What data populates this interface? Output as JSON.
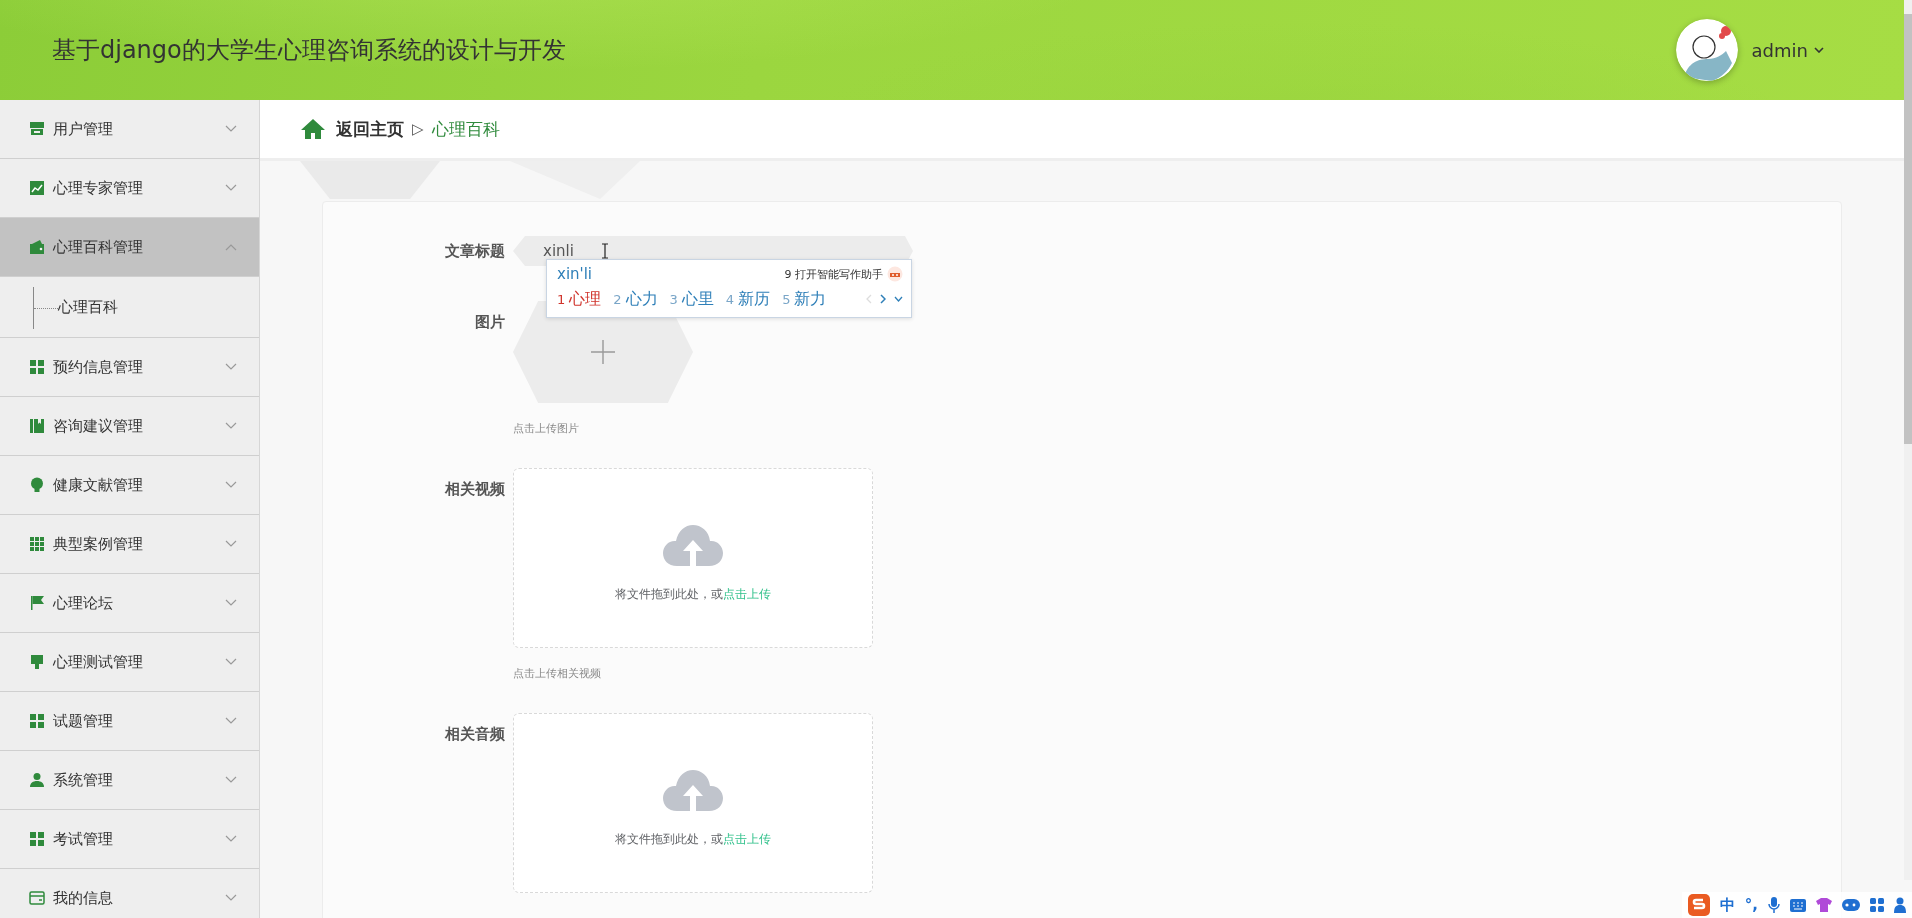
{
  "header": {
    "title": "基于django的大学生心理咨询系统的设计与开发",
    "user": {
      "name": "admin"
    }
  },
  "sidebar": {
    "items": [
      {
        "label": "用户管理",
        "expanded": false,
        "selected": false
      },
      {
        "label": "心理专家管理",
        "expanded": false,
        "selected": false
      },
      {
        "label": "心理百科管理",
        "expanded": true,
        "selected": true,
        "children": [
          {
            "label": "心理百科",
            "selected": false
          }
        ]
      },
      {
        "label": "预约信息管理",
        "expanded": false,
        "selected": false
      },
      {
        "label": "咨询建议管理",
        "expanded": false,
        "selected": false
      },
      {
        "label": "健康文献管理",
        "expanded": false,
        "selected": false
      },
      {
        "label": "典型案例管理",
        "expanded": false,
        "selected": false
      },
      {
        "label": "心理论坛",
        "expanded": false,
        "selected": false
      },
      {
        "label": "心理测试管理",
        "expanded": false,
        "selected": false
      },
      {
        "label": "试题管理",
        "expanded": false,
        "selected": false
      },
      {
        "label": "系统管理",
        "expanded": false,
        "selected": false
      },
      {
        "label": "考试管理",
        "expanded": false,
        "selected": false
      },
      {
        "label": "我的信息",
        "expanded": false,
        "selected": false
      }
    ]
  },
  "breadcrumb": {
    "home": "返回主页",
    "separator": "▷",
    "current": "心理百科"
  },
  "form": {
    "fields": [
      {
        "kind": "text",
        "label": "文章标题",
        "value": "xinli"
      },
      {
        "kind": "image",
        "label": "图片",
        "hint": "点击上传图片"
      },
      {
        "kind": "dropzone",
        "label": "相关视频",
        "prompt": "将文件拖到此处，或",
        "link": "点击上传",
        "hint": "点击上传相关视频"
      },
      {
        "kind": "dropzone",
        "label": "相关音频",
        "prompt": "将文件拖到此处，或",
        "link": "点击上传"
      }
    ]
  },
  "ime_popup": {
    "composition": "xin'li",
    "assistant": "9 打开智能写作助手",
    "candidates": [
      {
        "number": "1",
        "text": "心理",
        "selected": true
      },
      {
        "number": "2",
        "text": "心力",
        "selected": false
      },
      {
        "number": "3",
        "text": "心里",
        "selected": false
      },
      {
        "number": "4",
        "text": "新历",
        "selected": false
      },
      {
        "number": "5",
        "text": "新力",
        "selected": false
      }
    ]
  },
  "ime_toolbar": {
    "items": [
      "中",
      "°,"
    ]
  }
}
